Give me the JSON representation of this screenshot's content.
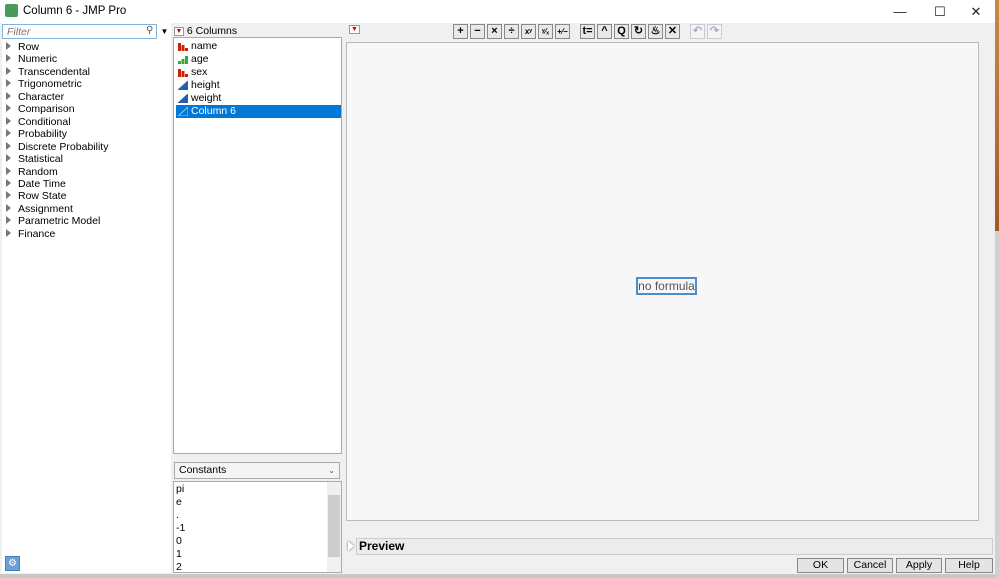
{
  "window": {
    "title": "Column 6 - JMP Pro"
  },
  "functions": {
    "filter_placeholder": "Filter",
    "items": [
      "Row",
      "Numeric",
      "Transcendental",
      "Trigonometric",
      "Character",
      "Comparison",
      "Conditional",
      "Probability",
      "Discrete Probability",
      "Statistical",
      "Random",
      "Date Time",
      "Row State",
      "Assignment",
      "Parametric Model",
      "Finance"
    ]
  },
  "columns": {
    "header": "6 Columns",
    "items": [
      {
        "label": "name",
        "type": "nominal"
      },
      {
        "label": "age",
        "type": "ordinal"
      },
      {
        "label": "sex",
        "type": "nominal"
      },
      {
        "label": "height",
        "type": "continuous"
      },
      {
        "label": "weight",
        "type": "continuous"
      },
      {
        "label": "Column 6",
        "type": "continuous",
        "selected": true
      }
    ]
  },
  "constants": {
    "selected": "Constants",
    "items": [
      "pi",
      "e",
      ".",
      "-1",
      "0",
      "1",
      "2"
    ]
  },
  "toolbar": [
    "+",
    "−",
    "×",
    "÷",
    "xʸ",
    "ʸ⁄ₓ",
    "+⁄−",
    "t=",
    "^",
    "Q",
    "↻",
    "♨",
    "✕",
    "↶",
    "↷"
  ],
  "editor": {
    "placeholder": "no formula"
  },
  "preview": {
    "label": "Preview"
  },
  "buttons": {
    "ok": "OK",
    "cancel": "Cancel",
    "apply": "Apply",
    "help": "Help"
  },
  "colors": {
    "selection": "#0078d7",
    "nominal": "#cc2200",
    "ordinal": "#3aa63a",
    "continuous": "#2a5db0"
  }
}
